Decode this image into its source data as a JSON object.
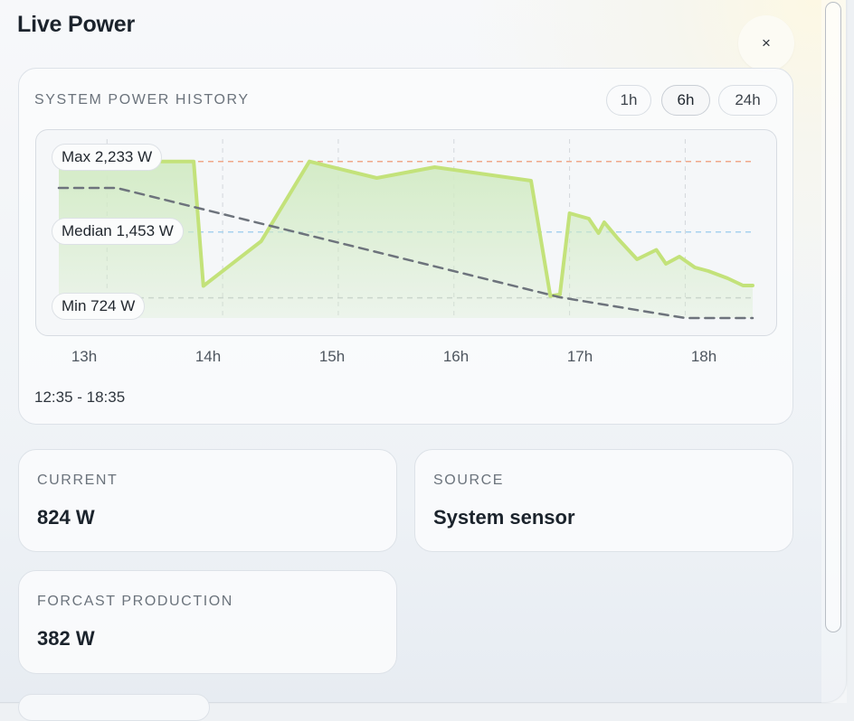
{
  "title": "Live Power",
  "close_label": "×",
  "history": {
    "label": "SYSTEM POWER HISTORY",
    "ranges": [
      "1h",
      "6h",
      "24h"
    ],
    "active_range": "6h",
    "refs": {
      "max": "Max 2,233 W",
      "median": "Median 1,453 W",
      "min": "Min 724 W"
    },
    "time_range": "12:35 - 18:35",
    "colors": {
      "line": "#c3e27a",
      "fill": "#d2ebc4",
      "max_ref": "#f0a88a",
      "median_ref": "#a7d2ee",
      "min_ref": "#c6cbd1",
      "forecast": "#6d737c"
    }
  },
  "chart_data": {
    "type": "line",
    "x_labels": [
      "13h",
      "14h",
      "15h",
      "16h",
      "17h",
      "18h"
    ],
    "xlim": [
      "12:35",
      "18:35"
    ],
    "ylim": [
      500,
      2400
    ],
    "reference_lines": [
      {
        "label": "Max",
        "value": 2233
      },
      {
        "label": "Median",
        "value": 1453
      },
      {
        "label": "Min",
        "value": 724
      }
    ],
    "series": [
      {
        "x": [
          "12:35",
          "13:45",
          "13:50",
          "14:20",
          "14:45",
          "15:20",
          "15:50",
          "16:40",
          "16:50",
          "16:55",
          "17:00",
          "17:10",
          "17:15",
          "17:18",
          "17:25",
          "17:35",
          "17:45",
          "17:50",
          "17:57",
          "18:05",
          "18:12",
          "18:22",
          "18:30",
          "18:35"
        ],
        "values": [
          2233,
          2233,
          855,
          1350,
          2233,
          2050,
          2170,
          2020,
          745,
          760,
          1660,
          1600,
          1440,
          1560,
          1380,
          1150,
          1255,
          1100,
          1180,
          1060,
          1020,
          940,
          860,
          860
        ],
        "style": "solid-filled"
      },
      {
        "x": [
          "12:35",
          "13:05",
          "16:55",
          "18:00",
          "18:35"
        ],
        "values": [
          1940,
          1940,
          730,
          500,
          500
        ],
        "style": "dashed"
      }
    ]
  },
  "stats": {
    "current": {
      "label": "CURRENT",
      "value": "824 W"
    },
    "source": {
      "label": "SOURCE",
      "value": "System sensor"
    },
    "forecast": {
      "label": "FORCAST PRODUCTION",
      "value": "382 W"
    }
  }
}
